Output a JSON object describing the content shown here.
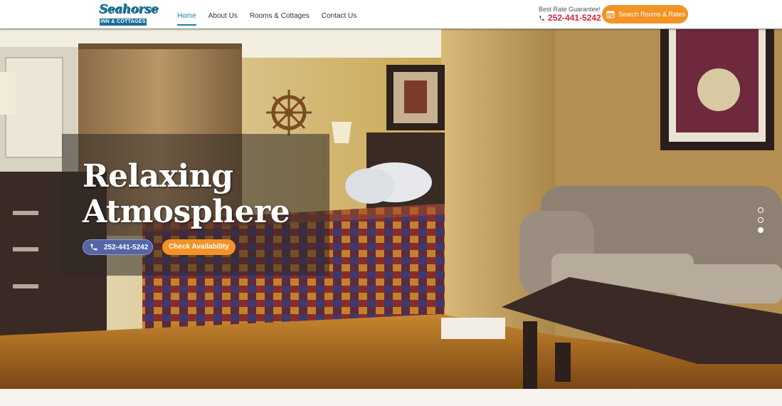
{
  "logo": {
    "script": "Seahorse",
    "subtitle": "INN & COTTAGES"
  },
  "nav": {
    "items": [
      {
        "label": "Home",
        "active": true
      },
      {
        "label": "About Us",
        "active": false
      },
      {
        "label": "Rooms & Cottages",
        "active": false
      },
      {
        "label": "Contact Us",
        "active": false
      }
    ]
  },
  "header": {
    "rate_label": "Best Rate Guarantee!",
    "phone": "252-441-5242",
    "search_button": "Search Rooms & Rates",
    "search_icon": "calendar-icon"
  },
  "hero": {
    "title_line1": "Relaxing",
    "title_line2": "Atmosphere",
    "phone_button": "252-441-5242",
    "check_button": "Check Availability",
    "slide_count": 3,
    "active_slide": 3
  },
  "colors": {
    "accent_orange": "#f39325",
    "phone_red": "#d7263d",
    "nav_active": "#1c7fa6",
    "phone_button": "#5565a8"
  }
}
